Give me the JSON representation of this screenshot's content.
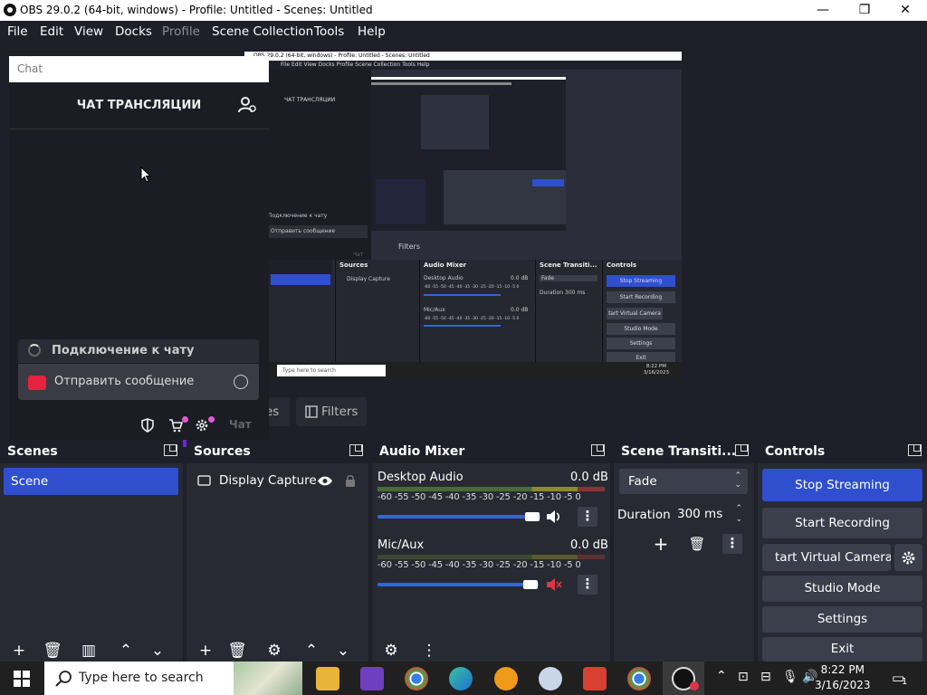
{
  "window": {
    "title": "OBS 29.0.2 (64-bit, windows) - Profile: Untitled - Scenes: Untitled",
    "minimize": "—",
    "restore": "❐",
    "close": "✕"
  },
  "menu": [
    {
      "label": "File"
    },
    {
      "label": "Edit"
    },
    {
      "label": "View"
    },
    {
      "label": "Docks"
    },
    {
      "label": "Profile"
    },
    {
      "label": "Scene Collection"
    },
    {
      "label": "Tools"
    },
    {
      "label": "Help"
    }
  ],
  "chat": {
    "placeholder": "Chat",
    "heading": "ЧАТ ТРАНСЛЯЦИИ",
    "connecting": "Подключение к чату",
    "send_message": "Отправить сообщение",
    "chat_button": "Чат"
  },
  "capture": {
    "title": "OBS 29.0.2 (64-bit, windows) - Profile: Untitled - Scenes: Untitled",
    "menu": "File   Edit   View   Docks   Profile   Scene Collection   Tools   Help",
    "chat_heading": "ЧАТ ТРАНСЛЯЦИИ",
    "connecting": "Подключение к чату",
    "send_message": "Отправить сообщение",
    "chat_button": "Чат",
    "filters": "Filters",
    "sources": "Sources",
    "display_capture": "Display Capture",
    "audio_mixer": "Audio Mixer",
    "desktop_audio": "Desktop Audio",
    "mic_aux": "Mic/Aux",
    "db": "0.0 dB",
    "ticks": "-60 -55 -50 -45 -40 -35 -30 -25 -20 -15 -10 -5 0",
    "scene_transitions": "Scene Transiti...",
    "fade": "Fade",
    "duration": "Duration",
    "ms": "300 ms",
    "controls": "Controls",
    "stop_streaming": "Stop Streaming",
    "start_recording": "Start Recording",
    "start_virtual_camera": "tart Virtual Camera",
    "studio_mode": "Studio Mode",
    "settings": "Settings",
    "exit": "Exit",
    "search": "Type here to search",
    "time": "8:22 PM",
    "date": "3/16/2023"
  },
  "tabs_behind": {
    "partial": "es",
    "filters": "Filters"
  },
  "scenes": {
    "title": "Scenes",
    "items": [
      {
        "label": "Scene"
      }
    ]
  },
  "sources": {
    "title": "Sources",
    "items": [
      {
        "label": "Display Capture"
      }
    ]
  },
  "audio_mixer": {
    "title": "Audio Mixer",
    "channels": [
      {
        "name": "Desktop Audio",
        "db": "0.0 dB",
        "volume": 1.0,
        "muted": false
      },
      {
        "name": "Mic/Aux",
        "db": "0.0 dB",
        "volume": 1.0,
        "muted": true
      }
    ],
    "ticks": "-60 -55 -50 -45 -40 -35 -30 -25 -20 -15 -10 -5 0"
  },
  "transitions": {
    "title": "Scene Transiti...",
    "selected": "Fade",
    "duration_label": "Duration",
    "duration_value": "300 ms"
  },
  "controls": {
    "title": "Controls",
    "stop_streaming": "Stop Streaming",
    "start_recording": "Start Recording",
    "start_virtual_camera": "tart Virtual Camera",
    "studio_mode": "Studio Mode",
    "settings": "Settings",
    "exit": "Exit"
  },
  "taskbar": {
    "search_placeholder": "Type here to search",
    "time": "8:22 PM",
    "date": "3/16/2023",
    "notification_count": "1"
  },
  "colors": {
    "accent": "#2f4fcf",
    "panel": "#272a33",
    "background": "#1e1f29",
    "twitch_purple": "#6f22e0",
    "muted_red": "#e0334a"
  }
}
